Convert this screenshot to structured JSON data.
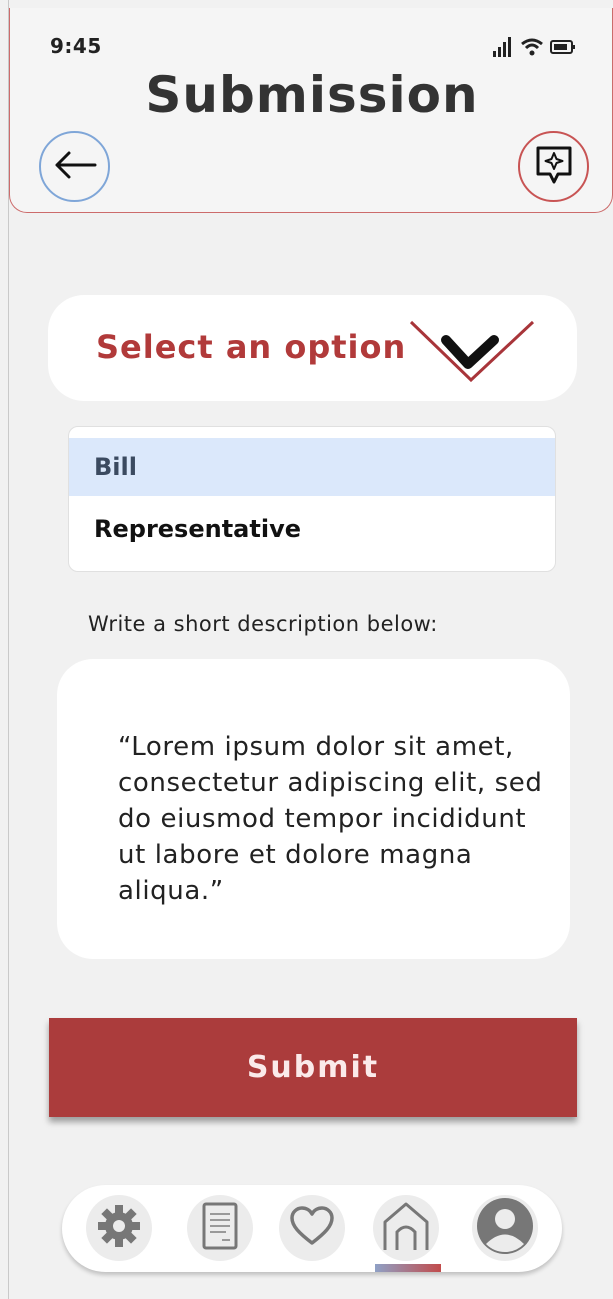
{
  "status_bar": {
    "time": "9:45"
  },
  "header": {
    "title": "Submission"
  },
  "select": {
    "placeholder": "Select an option",
    "options": [
      {
        "label": "Bill",
        "selected": true
      },
      {
        "label": "Representative",
        "selected": false
      }
    ]
  },
  "description": {
    "label": "Write a short description below:",
    "text": "“Lorem ipsum dolor sit amet, consectetur adipiscing elit, sed do eiusmod tempor incididunt ut labore et dolore magna aliqua.”"
  },
  "submit": {
    "label": "Submit"
  },
  "bottom_nav": {
    "items": [
      {
        "icon": "gear-icon",
        "active": false
      },
      {
        "icon": "document-icon",
        "active": false
      },
      {
        "icon": "heart-icon",
        "active": false
      },
      {
        "icon": "home-icon",
        "active": true
      },
      {
        "icon": "profile-icon",
        "active": false
      }
    ]
  },
  "colors": {
    "accent": "#ab3c3c",
    "selected_option_bg": "#dbe8fb",
    "back_button_border": "#7fa6d8"
  }
}
